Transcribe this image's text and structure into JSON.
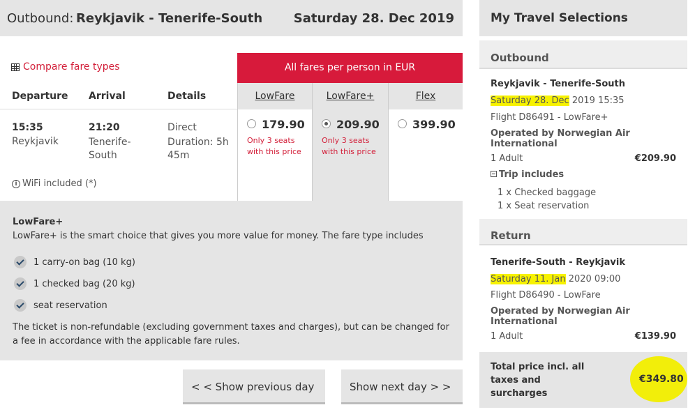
{
  "header": {
    "direction": "Outbound:",
    "route": "Reykjavik - Tenerife-South",
    "date": "Saturday 28. Dec 2019"
  },
  "compare_link": "Compare fare types",
  "columns": {
    "departure": "Departure",
    "arrival": "Arrival",
    "details": "Details"
  },
  "fares_banner": "All fares per person in EUR",
  "fare_tabs": [
    "LowFare",
    "LowFare+",
    "Flex"
  ],
  "flight": {
    "dep_time": "15:35",
    "dep_city": "Reykjavik",
    "arr_time": "21:20",
    "arr_city": "Tenerife-South",
    "type": "Direct",
    "duration": "Duration: 5h 45m",
    "wifi": "WiFi included (*)"
  },
  "fares": [
    {
      "price": "179.90",
      "note": "Only 3 seats with this price",
      "selected": false
    },
    {
      "price": "209.90",
      "note": "Only 3 seats with this price",
      "selected": true
    },
    {
      "price": "399.90",
      "note": "",
      "selected": false
    }
  ],
  "fare_info": {
    "title": "LowFare+",
    "description": "LowFare+ is the smart choice that gives you more value for money. The fare type includes",
    "items": [
      "1 carry-on bag (10 kg)",
      "1 checked bag (20 kg)",
      "seat reservation"
    ],
    "footer": "The ticket is non-refundable (excluding government taxes and charges), but can be changed for a fee in accordance with the applicable fare rules."
  },
  "nav": {
    "prev": "< < Show previous day",
    "next": "Show next day > >"
  },
  "selections": {
    "title": "My Travel Selections",
    "outbound": {
      "label": "Outbound",
      "route": "Reykjavik - Tenerife-South",
      "date_highlight": "Saturday 28. Dec",
      "date_rest": "2019 15:35",
      "flight": "Flight D86491 - LowFare+",
      "operator": "Operated by Norwegian Air International",
      "pax": "1 Adult",
      "amount": "€209.90",
      "includes_label": "Trip includes",
      "includes": [
        "1 x Checked baggage",
        "1 x Seat reservation"
      ]
    },
    "return": {
      "label": "Return",
      "route": "Tenerife-South - Reykjavik",
      "date_highlight": "Saturday 11. Jan",
      "date_rest": "2020 09:00",
      "flight": "Flight D86490 - LowFare",
      "operator": "Operated by Norwegian Air International",
      "pax": "1 Adult",
      "amount": "€139.90"
    },
    "total_label": "Total price incl. all taxes and surcharges",
    "total_amount": "€349.80",
    "highlight_color": "#f7f200"
  },
  "colors": {
    "accent": "#d71a3b",
    "panel": "#e5e5e5"
  }
}
